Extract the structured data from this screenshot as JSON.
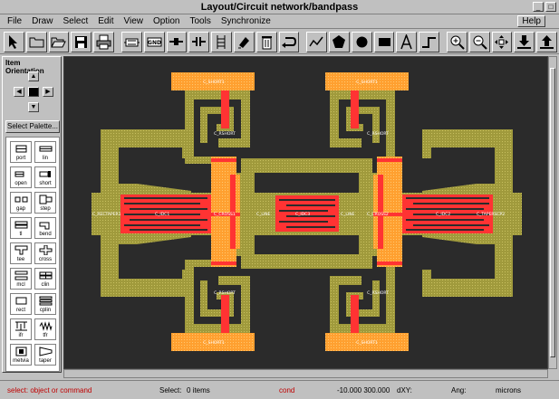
{
  "window": {
    "title": "Layout/Circuit network/bandpass"
  },
  "menus": [
    "File",
    "Draw",
    "Select",
    "Edit",
    "View",
    "Option",
    "Tools",
    "Synchronize"
  ],
  "help_menu": "Help",
  "toolbar_icons": [
    "pointer-icon",
    "folder-icon",
    "open-folder-icon",
    "save-disk-icon",
    "print-icon",
    "component-icon",
    "gnd-icon",
    "port-icon",
    "dc-block-icon",
    "wire-ladder-icon",
    "rotate-icon",
    "delete-icon",
    "undo-icon",
    "line-icon",
    "polygon-icon",
    "circle-icon",
    "rectangle-icon",
    "text-icon",
    "step-icon",
    "zoom-in-icon",
    "zoom-out-icon",
    "fit-icon",
    "download-icon",
    "upload-icon"
  ],
  "side": {
    "orientation_label": "Item Orientation",
    "select_palette_label": "Select Palette...",
    "palette_items": [
      "port",
      "lin",
      "open",
      "short",
      "gap",
      "step",
      "tl",
      "bend",
      "tee",
      "cross",
      "mcl",
      "clin",
      "rect",
      "cplin",
      "ifr",
      "tfr",
      "metvia",
      "taper"
    ]
  },
  "status": {
    "prompt": "select: object or command",
    "select_label": "Select:",
    "select_value": "0 items",
    "mode": "cond",
    "coords": "-10.000 300.000",
    "dxy_label": "dXY:",
    "ang_label": "Ang:",
    "units": "microns"
  },
  "colors": {
    "substrate": "#2b2b2b",
    "metal1": "#999933",
    "metal2": "#ff9933",
    "resistor": "#ff3333"
  },
  "layout_labels": {
    "short_top_left": "C_SHORT1",
    "short_top_right": "C_SHORT1",
    "short_bot_left": "C_SHORT1",
    "short_bot_right": "C_SHORT1",
    "induct_top_left": "C_RSHORT",
    "induct_top_right": "C_RSHORT",
    "induct_bot_left": "C_RSHORT",
    "induct_bot_right": "C_RSHORT",
    "taper_left": "C_RECTAPER1",
    "taper_right": "C_TAPERSCP2",
    "idc_left": "C_IDC1",
    "cross_left": "C_CROSS1",
    "tee_left": "C_LINE",
    "idc_mid": "C_IDC3",
    "tee_right": "C_LINE",
    "cross_right": "C_CROSS2",
    "idc_right": "C_IDC2"
  }
}
